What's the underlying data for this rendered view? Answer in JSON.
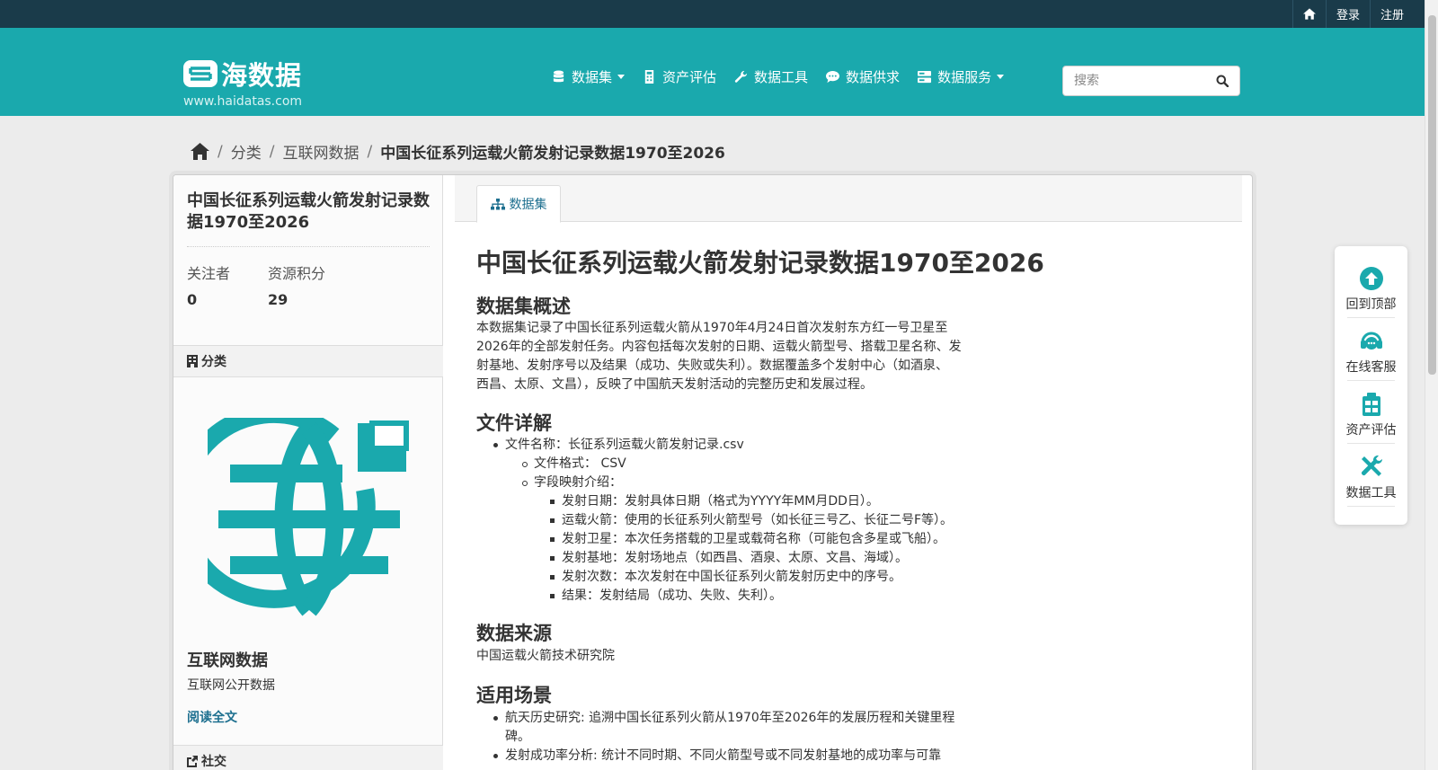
{
  "topbar": {
    "login": "登录",
    "register": "注册"
  },
  "brand": {
    "name": "海数据",
    "url": "www.haidatas.com"
  },
  "nav": [
    {
      "label": "数据集",
      "icon": "database-icon",
      "dropdown": true
    },
    {
      "label": "资产评估",
      "icon": "calculator-icon",
      "dropdown": false
    },
    {
      "label": "数据工具",
      "icon": "wrench-icon",
      "dropdown": false
    },
    {
      "label": "数据供求",
      "icon": "comment-icon",
      "dropdown": false
    },
    {
      "label": "数据服务",
      "icon": "server-icon",
      "dropdown": true
    }
  ],
  "search": {
    "placeholder": "搜索"
  },
  "breadcrumb": {
    "category": "分类",
    "group": "互联网数据",
    "current": "中国长征系列运载火箭发射记录数据1970至2026"
  },
  "sidebar": {
    "title": "中国长征系列运载火箭发射记录数据1970至2026",
    "followers_label": "关注者",
    "followers": "0",
    "score_label": "资源积分",
    "score": "29",
    "category_heading": "分类",
    "category_name": "互联网数据",
    "category_desc": "互联网公开数据",
    "read_more": "阅读全文",
    "social_heading": "社交"
  },
  "tab": {
    "label": "数据集"
  },
  "content": {
    "title": "中国长征系列运载火箭发射记录数据1970至2026",
    "overview_heading": "数据集概述",
    "overview_lines": [
      "本数据集记录了中国长征系列运载火箭从1970年4月24日首次发射东方红一号卫星至",
      "2026年的全部发射任务。内容包括每次发射的日期、运载火箭型号、搭载卫星名称、发",
      "射基地、发射序号以及结果（成功、失败或失利）。数据覆盖多个发射中心（如酒泉、",
      "西昌、太原、文昌），反映了中国航天发射活动的完整历史和发展过程。"
    ],
    "file_heading": "文件详解",
    "file_name": "文件名称：长征系列运载火箭发射记录.csv",
    "file_format": "文件格式： CSV",
    "field_intro": "字段映射介绍：",
    "fields": [
      "发射日期：发射具体日期（格式为YYYY年MM月DD日）。",
      "运载火箭：使用的长征系列火箭型号（如长征三号乙、长征二号F等）。",
      "发射卫星：本次任务搭载的卫星或载荷名称（可能包含多星或飞船）。",
      "发射基地：发射场地点（如西昌、酒泉、太原、文昌、海域）。",
      "发射次数：本次发射在中国长征系列火箭发射历史中的序号。",
      "结果：发射结局（成功、失败、失利）。"
    ],
    "source_heading": "数据来源",
    "source": "中国运载火箭技术研究院",
    "usage_heading": "适用场景",
    "usage": [
      "航天历史研究: 追溯中国长征系列火箭从1970年至2026年的发展历程和关键里程",
      "碑。",
      "发射成功率分析: 统计不同时期、不同火箭型号或不同发射基地的成功率与可靠"
    ]
  },
  "float_panel": [
    {
      "label": "回到顶部",
      "icon": "arrow-up-circle-icon"
    },
    {
      "label": "在线客服",
      "icon": "headset-icon"
    },
    {
      "label": "资产评估",
      "icon": "clipboard-icon"
    },
    {
      "label": "数据工具",
      "icon": "tools-icon"
    }
  ],
  "colors": {
    "topbar": "#1a3b4a",
    "brand": "#1aa9ad",
    "link": "#1d6f8f"
  }
}
